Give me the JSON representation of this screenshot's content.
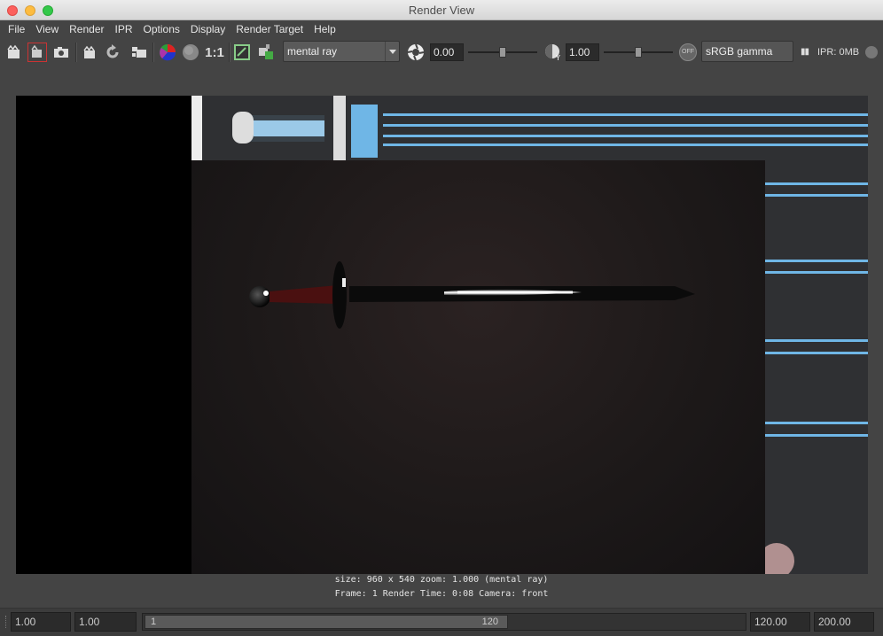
{
  "window": {
    "title": "Render View"
  },
  "menu": [
    "File",
    "View",
    "Render",
    "IPR",
    "Options",
    "Display",
    "Render Target",
    "Help"
  ],
  "toolbar": {
    "ratio_label": "1:1",
    "renderer": "mental ray",
    "exposure": "0.00",
    "gamma": "1.00",
    "colorspace_toggle": "OFF",
    "colorspace": "sRGB gamma",
    "pause": "▮▮",
    "ipr_memory": "IPR: 0MB"
  },
  "render_info": {
    "line1": "size: 960 x 540 zoom: 1.000      (mental ray)",
    "line2": "Frame: 1      Render Time: 0:08      Camera: front"
  },
  "timebar": {
    "start": "1.00",
    "current": "1.00",
    "range_start": "1",
    "range_end": "120",
    "end": "120.00",
    "max": "200.00"
  },
  "colors": {
    "accent_stripe": "#6fb6e6",
    "panel": "#444444"
  }
}
